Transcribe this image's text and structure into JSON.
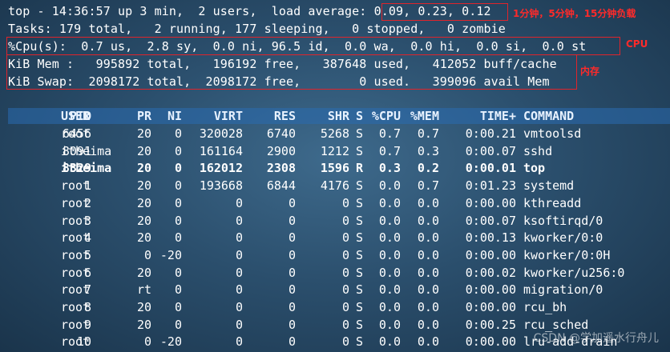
{
  "summary": {
    "line1": "top - 14:36:57 up 3 min,  2 users,  load average:",
    "load": "0.09, 0.23, 0.12",
    "line2": "Tasks: 179 total,   2 running, 177 sleeping,   0 stopped,   0 zombie",
    "line3": "%Cpu(s):  0.7 us,  2.8 sy,  0.0 ni, 96.5 id,  0.0 wa,  0.0 hi,  0.0 si,  0.0 st",
    "line4": "KiB Mem :   995892 total,   196192 free,   387648 used,   412052 buff/cache",
    "line5": "KiB Swap:  2098172 total,  2098172 free,        0 used.   399096 avail Mem"
  },
  "annotations": {
    "load_note": "1分钟，5分钟，15分钟负载",
    "cpu_note": "CPU",
    "mem_note": "内存",
    "color": "#e0242b"
  },
  "table": {
    "headers": [
      "PID",
      "USER",
      "PR",
      "NI",
      "VIRT",
      "RES",
      "SHR",
      "S",
      "%CPU",
      "%MEM",
      "TIME+",
      "COMMAND"
    ],
    "rows": [
      {
        "pid": "6456",
        "user": "root",
        "pr": "20",
        "ni": "0",
        "virt": "320028",
        "res": "6740",
        "shr": "5268",
        "s": "S",
        "cpu": "0.7",
        "mem": "0.7",
        "time": "0:00.21",
        "cmd": "vmtoolsd",
        "bold": false
      },
      {
        "pid": "8091",
        "user": "itheima",
        "pr": "20",
        "ni": "0",
        "virt": "161164",
        "res": "2900",
        "shr": "1212",
        "s": "S",
        "cpu": "0.7",
        "mem": "0.3",
        "time": "0:00.07",
        "cmd": "sshd",
        "bold": false
      },
      {
        "pid": "8329",
        "user": "itheima",
        "pr": "20",
        "ni": "0",
        "virt": "162012",
        "res": "2308",
        "shr": "1596",
        "s": "R",
        "cpu": "0.3",
        "mem": "0.2",
        "time": "0:00.01",
        "cmd": "top",
        "bold": true
      },
      {
        "pid": "1",
        "user": "root",
        "pr": "20",
        "ni": "0",
        "virt": "193668",
        "res": "6844",
        "shr": "4176",
        "s": "S",
        "cpu": "0.0",
        "mem": "0.7",
        "time": "0:01.23",
        "cmd": "systemd",
        "bold": false
      },
      {
        "pid": "2",
        "user": "root",
        "pr": "20",
        "ni": "0",
        "virt": "0",
        "res": "0",
        "shr": "0",
        "s": "S",
        "cpu": "0.0",
        "mem": "0.0",
        "time": "0:00.00",
        "cmd": "kthreadd",
        "bold": false
      },
      {
        "pid": "3",
        "user": "root",
        "pr": "20",
        "ni": "0",
        "virt": "0",
        "res": "0",
        "shr": "0",
        "s": "S",
        "cpu": "0.0",
        "mem": "0.0",
        "time": "0:00.07",
        "cmd": "ksoftirqd/0",
        "bold": false
      },
      {
        "pid": "4",
        "user": "root",
        "pr": "20",
        "ni": "0",
        "virt": "0",
        "res": "0",
        "shr": "0",
        "s": "S",
        "cpu": "0.0",
        "mem": "0.0",
        "time": "0:00.13",
        "cmd": "kworker/0:0",
        "bold": false
      },
      {
        "pid": "5",
        "user": "root",
        "pr": "0",
        "ni": "-20",
        "virt": "0",
        "res": "0",
        "shr": "0",
        "s": "S",
        "cpu": "0.0",
        "mem": "0.0",
        "time": "0:00.00",
        "cmd": "kworker/0:0H",
        "bold": false
      },
      {
        "pid": "6",
        "user": "root",
        "pr": "20",
        "ni": "0",
        "virt": "0",
        "res": "0",
        "shr": "0",
        "s": "S",
        "cpu": "0.0",
        "mem": "0.0",
        "time": "0:00.02",
        "cmd": "kworker/u256:0",
        "bold": false
      },
      {
        "pid": "7",
        "user": "root",
        "pr": "rt",
        "ni": "0",
        "virt": "0",
        "res": "0",
        "shr": "0",
        "s": "S",
        "cpu": "0.0",
        "mem": "0.0",
        "time": "0:00.00",
        "cmd": "migration/0",
        "bold": false
      },
      {
        "pid": "8",
        "user": "root",
        "pr": "20",
        "ni": "0",
        "virt": "0",
        "res": "0",
        "shr": "0",
        "s": "S",
        "cpu": "0.0",
        "mem": "0.0",
        "time": "0:00.00",
        "cmd": "rcu_bh",
        "bold": false
      },
      {
        "pid": "9",
        "user": "root",
        "pr": "20",
        "ni": "0",
        "virt": "0",
        "res": "0",
        "shr": "0",
        "s": "S",
        "cpu": "0.0",
        "mem": "0.0",
        "time": "0:00.25",
        "cmd": "rcu_sched",
        "bold": false
      },
      {
        "pid": "10",
        "user": "root",
        "pr": "0",
        "ni": "-20",
        "virt": "0",
        "res": "0",
        "shr": "0",
        "s": "S",
        "cpu": "0.0",
        "mem": "0.0",
        "time": "0:00.00",
        "cmd": "lru-add-drain",
        "bold": false
      }
    ]
  },
  "watermark": "CSDN @学加遥水行舟儿"
}
